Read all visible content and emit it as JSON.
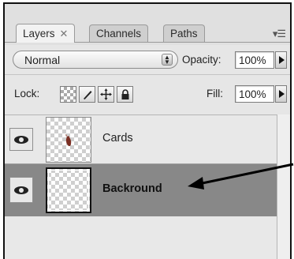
{
  "tabs": [
    {
      "label": "Layers",
      "close": "✕",
      "active": true
    },
    {
      "label": "Channels",
      "active": false
    },
    {
      "label": "Paths",
      "active": false
    }
  ],
  "panel_menu_icon": "panel-menu-icon",
  "blend_mode": {
    "value": "Normal"
  },
  "opacity": {
    "label": "Opacity:",
    "value": "100%"
  },
  "lock": {
    "label": "Lock:",
    "icons": [
      "lock-transparent-pixels-icon",
      "lock-image-pixels-icon",
      "lock-position-icon",
      "lock-all-icon"
    ]
  },
  "fill": {
    "label": "Fill:",
    "value": "100%"
  },
  "layers": [
    {
      "name": "Cards",
      "visible": true,
      "selected": false
    },
    {
      "name": "Backround",
      "visible": true,
      "selected": true
    }
  ],
  "colors": {
    "selected_row": "#888888",
    "panel_bg": "#e6e6e6",
    "annotation_arrow": "#000000"
  }
}
